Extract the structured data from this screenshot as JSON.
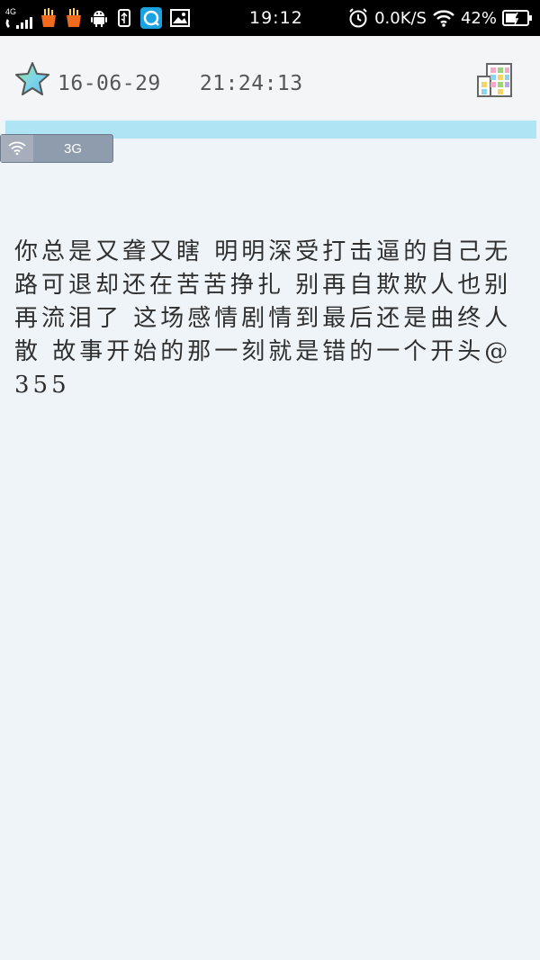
{
  "status_bar": {
    "network_type": "4G",
    "time": "19:12",
    "speed": "0.0K/S",
    "battery": "42%",
    "icons": [
      "call-signal-icon",
      "fries-icon",
      "fries-icon",
      "android-icon",
      "usb-icon",
      "browser-app-icon",
      "gallery-icon",
      "alarm-icon",
      "wifi-icon",
      "battery-icon"
    ]
  },
  "header": {
    "date": "16-06-29",
    "time": "21:24:13"
  },
  "network_pill": {
    "label": "3G"
  },
  "note": {
    "text": "你总是又聋又瞎 明明深受打击逼的自己无路可退却还在苦苦挣扎 别再自欺欺人也别再流泪了 这场感情剧情到最后还是曲终人散 故事开始的那一刻就是错的一个开头@355"
  },
  "colors": {
    "background": "#eef4f7",
    "header": "#f4f5f6",
    "accent_strip": "#aee4f4",
    "text": "#2f2f2f"
  }
}
